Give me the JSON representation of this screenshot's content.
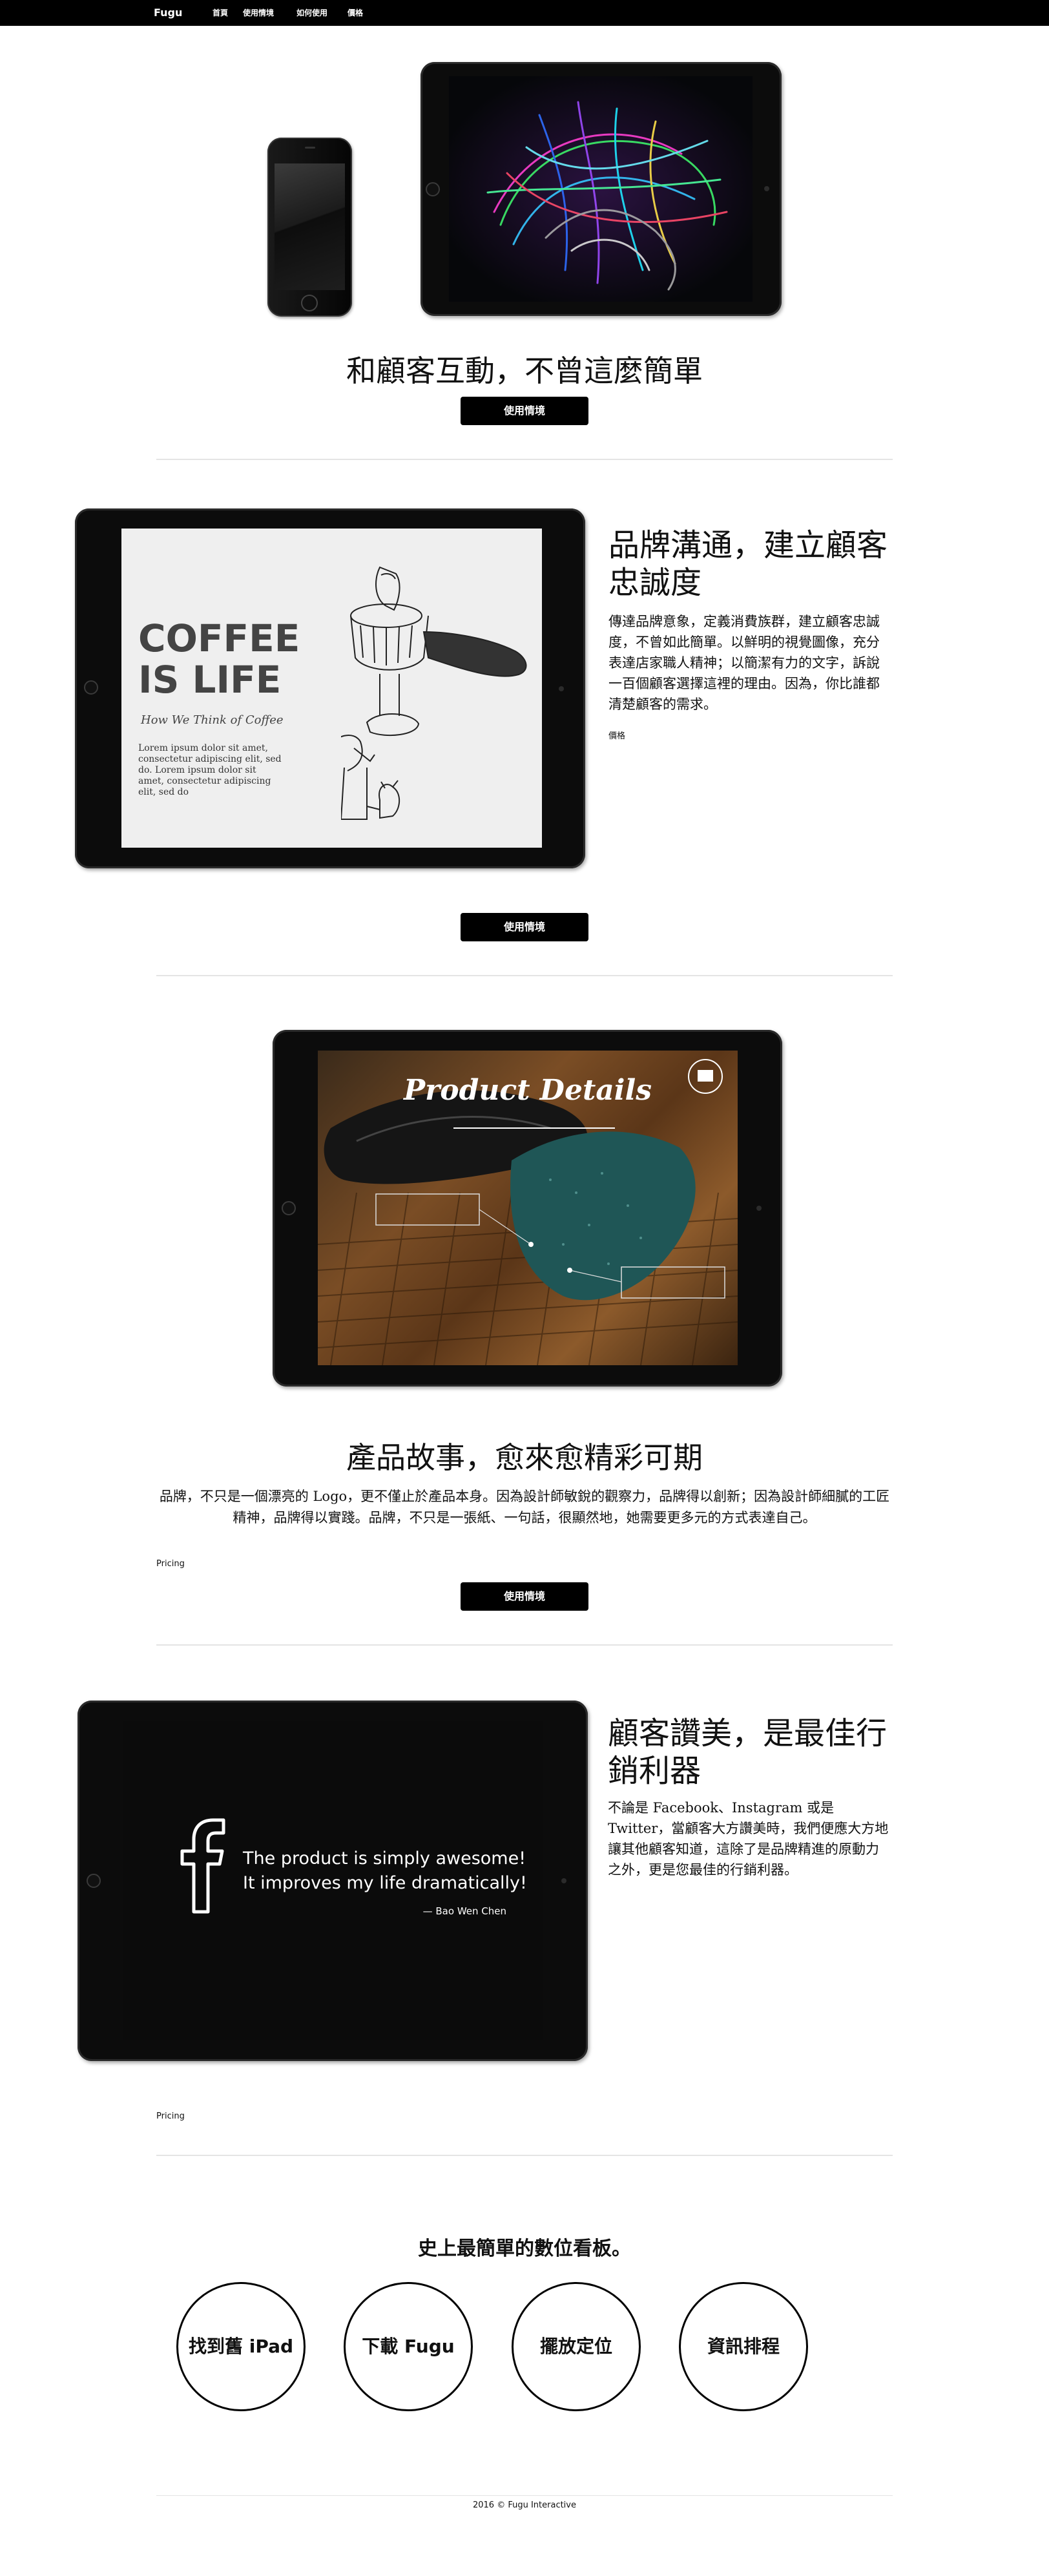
{
  "nav": {
    "brand": "Fugu",
    "links": [
      "首頁",
      "使用情境",
      "如何使用",
      "價格"
    ]
  },
  "hero": {
    "title": "和顧客互動，不曾這麼簡單",
    "button": "使用情境"
  },
  "brand_section": {
    "heading": "品牌溝通，建立顧客忠誠度",
    "body": "傳達品牌意象，定義消費族群，建立顧客忠誠度，不曾如此簡單。以鮮明的視覺圖像，充分表達店家職人精神；以簡潔有力的文字，訴說一百個顧客選擇這裡的理由。因為，你比誰都清楚顧客的需求。",
    "link": "價格",
    "button": "使用情境",
    "screen": {
      "title_line1": "COFFEE",
      "title_line2": "IS LIFE",
      "subtitle": "How We Think of Coffee",
      "lorem": "Lorem ipsum dolor sit amet, consectetur adipiscing elit, sed do. Lorem ipsum dolor sit amet, consectetur adipiscing elit, sed do"
    }
  },
  "product_section": {
    "heading": "產品故事，愈來愈精彩可期",
    "body": "品牌，不只是一個漂亮的 Logo，更不僅止於產品本身。因為設計師敏銳的觀察力，品牌得以創新；因為設計師細膩的工匠精神，品牌得以實踐。品牌，不只是一張紙、一句話，很顯然地，她需要更多元的方式表達自己。",
    "link": "Pricing",
    "button": "使用情境",
    "screen": {
      "title": "Product Details"
    }
  },
  "praise_section": {
    "heading": "顧客讚美，是最佳行銷利器",
    "body": "不論是 Facebook、Instagram 或是 Twitter，當顧客大方讚美時，我們便應大方地讓其他顧客知道，這除了是品牌精進的原動力之外，更是您最佳的行銷利器。",
    "link": "Pricing",
    "screen": {
      "quote_line1": "The product is simply awesome!",
      "quote_line2": "It improves my life dramatically!",
      "author": "— Bao Wen Chen"
    }
  },
  "steps": {
    "heading": "史上最簡單的數位看板。",
    "items": [
      "找到舊 iPad",
      "下載 Fugu",
      "擺放定位",
      "資訊排程"
    ]
  },
  "footer": {
    "text": "2016 © Fugu Interactive"
  },
  "colors": {
    "nav_bg": "#000000",
    "button_bg": "#000000",
    "divider": "#e4e4e4",
    "coffee_screen_bg": "#efefef",
    "praise_screen_bg": "#0b0b0b"
  }
}
